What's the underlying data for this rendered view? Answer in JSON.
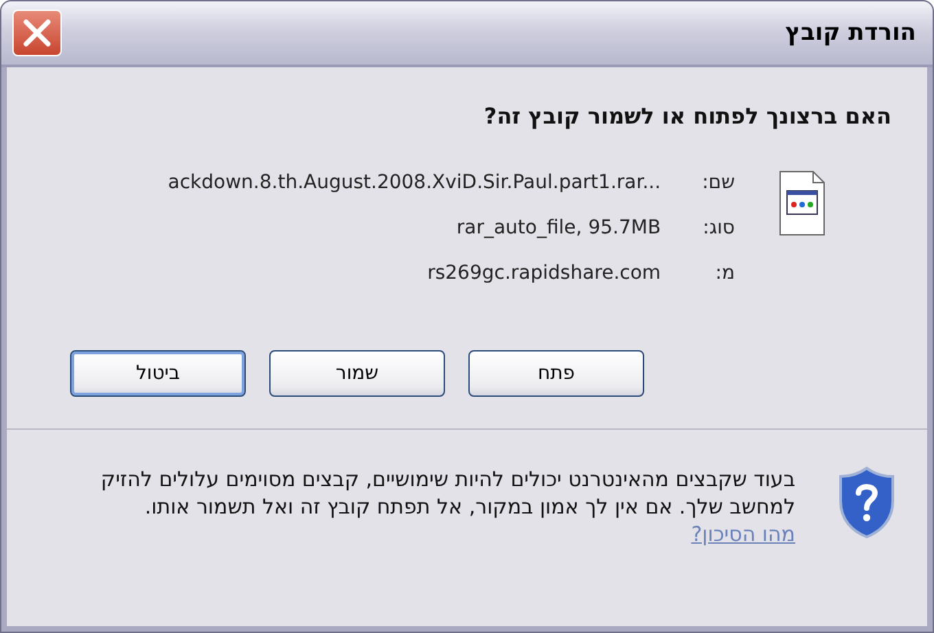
{
  "window": {
    "title": "הורדת קובץ"
  },
  "question": "האם ברצונך לפתוח או לשמור קובץ זה?",
  "details": [
    {
      "label": "שם:",
      "value": "ackdown.8.th.August.2008.XviD.Sir.Paul.part1.rar..."
    },
    {
      "label": "סוג:",
      "value": "rar_auto_file, 95.7MB"
    },
    {
      "label": "מ:",
      "value": "rs269gc.rapidshare.com"
    }
  ],
  "buttons": [
    {
      "label": "פתח",
      "default": false
    },
    {
      "label": "שמור",
      "default": false
    },
    {
      "label": "ביטול",
      "default": true
    }
  ],
  "warning": {
    "text": "בעוד שקבצים מהאינטרנט יכולים להיות שימושיים, קבצים מסוימים עלולים להזיק למחשב שלך. אם אין לך אמון במקור, אל תפתח קובץ זה ואל תשמור אותו.",
    "link": "מהו הסיכון?"
  }
}
